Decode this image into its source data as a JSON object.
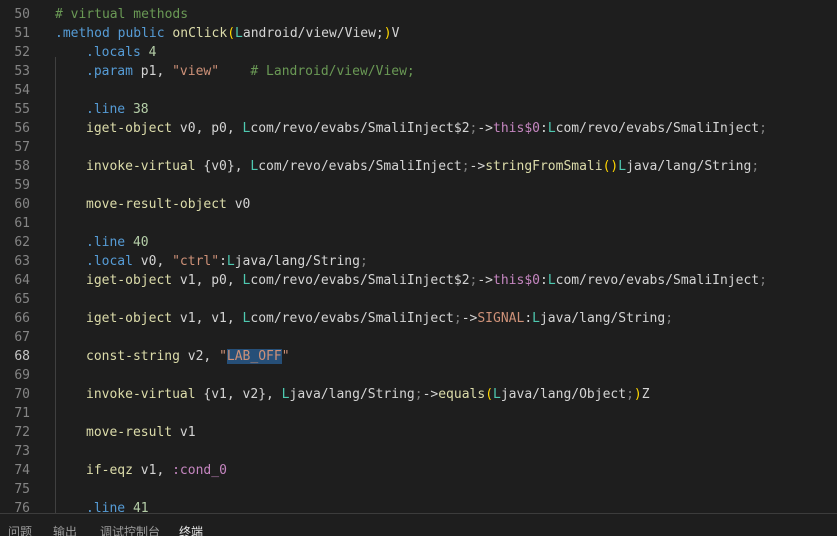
{
  "editor": {
    "active_line": "68",
    "lines": [
      {
        "n": "50",
        "indent": 0,
        "tokens": [
          [
            "t-comment",
            "# virtual methods"
          ]
        ]
      },
      {
        "n": "51",
        "indent": 0,
        "tokens": [
          [
            "t-directive",
            ".method"
          ],
          [
            "t-plain",
            " "
          ],
          [
            "t-kw",
            "public"
          ],
          [
            "t-plain",
            " "
          ],
          [
            "t-method",
            "onClick"
          ],
          [
            "t-paren",
            "("
          ],
          [
            "t-L",
            "L"
          ],
          [
            "t-plain",
            "android/view/View;"
          ],
          [
            "t-paren",
            ")"
          ],
          [
            "t-plain",
            "V"
          ]
        ]
      },
      {
        "n": "52",
        "indent": 1,
        "tokens": [
          [
            "t-directive",
            ".locals"
          ],
          [
            "t-plain",
            " "
          ],
          [
            "t-num",
            "4"
          ]
        ]
      },
      {
        "n": "53",
        "indent": 1,
        "tokens": [
          [
            "t-directive",
            ".param"
          ],
          [
            "t-plain",
            " p1, "
          ],
          [
            "t-str",
            "\"view\""
          ],
          [
            "t-plain",
            "    "
          ],
          [
            "t-comment",
            "# Landroid/view/View;"
          ]
        ]
      },
      {
        "n": "54",
        "indent": 1,
        "tokens": []
      },
      {
        "n": "55",
        "indent": 1,
        "tokens": [
          [
            "t-directive",
            ".line"
          ],
          [
            "t-plain",
            " "
          ],
          [
            "t-num",
            "38"
          ]
        ]
      },
      {
        "n": "56",
        "indent": 1,
        "tokens": [
          [
            "t-func",
            "iget-object"
          ],
          [
            "t-plain",
            " v0, p0, "
          ],
          [
            "t-L",
            "L"
          ],
          [
            "t-plain",
            "com/revo/evabs/SmaliInject$2"
          ],
          [
            "t-semi",
            ";"
          ],
          [
            "t-plain",
            "->"
          ],
          [
            "t-this",
            "this$0"
          ],
          [
            "t-plain",
            ":"
          ],
          [
            "t-L",
            "L"
          ],
          [
            "t-plain",
            "com/revo/evabs/SmaliInject"
          ],
          [
            "t-semi",
            ";"
          ]
        ]
      },
      {
        "n": "57",
        "indent": 1,
        "tokens": []
      },
      {
        "n": "58",
        "indent": 1,
        "tokens": [
          [
            "t-func",
            "invoke-virtual"
          ],
          [
            "t-plain",
            " {v0}, "
          ],
          [
            "t-L",
            "L"
          ],
          [
            "t-plain",
            "com/revo/evabs/SmaliInject"
          ],
          [
            "t-semi",
            ";"
          ],
          [
            "t-plain",
            "->"
          ],
          [
            "t-method",
            "stringFromSmali"
          ],
          [
            "t-paren",
            "()"
          ],
          [
            "t-L",
            "L"
          ],
          [
            "t-plain",
            "java/lang/String"
          ],
          [
            "t-semi",
            ";"
          ]
        ]
      },
      {
        "n": "59",
        "indent": 1,
        "tokens": []
      },
      {
        "n": "60",
        "indent": 1,
        "tokens": [
          [
            "t-func",
            "move-result-object"
          ],
          [
            "t-plain",
            " v0"
          ]
        ]
      },
      {
        "n": "61",
        "indent": 1,
        "tokens": []
      },
      {
        "n": "62",
        "indent": 1,
        "tokens": [
          [
            "t-directive",
            ".line"
          ],
          [
            "t-plain",
            " "
          ],
          [
            "t-num",
            "40"
          ]
        ]
      },
      {
        "n": "63",
        "indent": 1,
        "tokens": [
          [
            "t-directive",
            ".local"
          ],
          [
            "t-plain",
            " v0, "
          ],
          [
            "t-str",
            "\"ctrl\""
          ],
          [
            "t-plain",
            ":"
          ],
          [
            "t-L",
            "L"
          ],
          [
            "t-plain",
            "java/lang/String"
          ],
          [
            "t-semi",
            ";"
          ]
        ]
      },
      {
        "n": "64",
        "indent": 1,
        "tokens": [
          [
            "t-func",
            "iget-object"
          ],
          [
            "t-plain",
            " v1, p0, "
          ],
          [
            "t-L",
            "L"
          ],
          [
            "t-plain",
            "com/revo/evabs/SmaliInject$2"
          ],
          [
            "t-semi",
            ";"
          ],
          [
            "t-plain",
            "->"
          ],
          [
            "t-this",
            "this$0"
          ],
          [
            "t-plain",
            ":"
          ],
          [
            "t-L",
            "L"
          ],
          [
            "t-plain",
            "com/revo/evabs/SmaliInject"
          ],
          [
            "t-semi",
            ";"
          ]
        ]
      },
      {
        "n": "65",
        "indent": 1,
        "tokens": []
      },
      {
        "n": "66",
        "indent": 1,
        "tokens": [
          [
            "t-func",
            "iget-object"
          ],
          [
            "t-plain",
            " v1, v1, "
          ],
          [
            "t-L",
            "L"
          ],
          [
            "t-plain",
            "com/revo/evabs/SmaliInject"
          ],
          [
            "t-semi",
            ";"
          ],
          [
            "t-plain",
            "->"
          ],
          [
            "t-signal",
            "SIGNAL"
          ],
          [
            "t-plain",
            ":"
          ],
          [
            "t-L",
            "L"
          ],
          [
            "t-plain",
            "java/lang/String"
          ],
          [
            "t-semi",
            ";"
          ]
        ]
      },
      {
        "n": "67",
        "indent": 1,
        "tokens": []
      },
      {
        "n": "68",
        "indent": 1,
        "tokens": [
          [
            "t-func",
            "const-string"
          ],
          [
            "t-plain",
            " v2, "
          ],
          [
            "t-str",
            "\""
          ],
          [
            "t-str t-hl",
            "LAB_OFF"
          ],
          [
            "t-str",
            "\""
          ]
        ]
      },
      {
        "n": "69",
        "indent": 1,
        "tokens": []
      },
      {
        "n": "70",
        "indent": 1,
        "tokens": [
          [
            "t-func",
            "invoke-virtual"
          ],
          [
            "t-plain",
            " {v1, v2}, "
          ],
          [
            "t-L",
            "L"
          ],
          [
            "t-plain",
            "java/lang/String"
          ],
          [
            "t-semi",
            ";"
          ],
          [
            "t-plain",
            "->"
          ],
          [
            "t-method",
            "equals"
          ],
          [
            "t-paren",
            "("
          ],
          [
            "t-L",
            "L"
          ],
          [
            "t-plain",
            "java/lang/Object"
          ],
          [
            "t-semi",
            ";"
          ],
          [
            "t-paren",
            ")"
          ],
          [
            "t-plain",
            "Z"
          ]
        ]
      },
      {
        "n": "71",
        "indent": 1,
        "tokens": []
      },
      {
        "n": "72",
        "indent": 1,
        "tokens": [
          [
            "t-func",
            "move-result"
          ],
          [
            "t-plain",
            " v1"
          ]
        ]
      },
      {
        "n": "73",
        "indent": 1,
        "tokens": []
      },
      {
        "n": "74",
        "indent": 1,
        "tokens": [
          [
            "t-func",
            "if-eqz"
          ],
          [
            "t-plain",
            " v1, "
          ],
          [
            "t-label",
            ":cond_0"
          ]
        ]
      },
      {
        "n": "75",
        "indent": 1,
        "tokens": []
      },
      {
        "n": "76",
        "indent": 1,
        "tokens": [
          [
            "t-directive",
            ".line"
          ],
          [
            "t-plain",
            " "
          ],
          [
            "t-num",
            "41"
          ]
        ]
      }
    ]
  },
  "panel": {
    "tabs": [
      {
        "id": "problems",
        "label": "问题",
        "active": false
      },
      {
        "id": "output",
        "label": "输出",
        "active": false
      },
      {
        "id": "debug-console",
        "label": "调试控制台",
        "active": false
      },
      {
        "id": "terminal",
        "label": "终端",
        "active": true
      }
    ]
  }
}
